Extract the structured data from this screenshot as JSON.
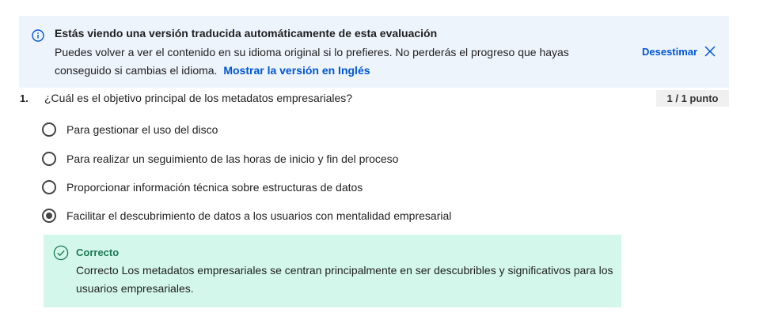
{
  "banner": {
    "title": "Estás viendo una versión traducida automáticamente de esta evaluación",
    "body": "Puedes volver a ver el contenido en su idioma original si lo prefieres. No perderás el progreso que hayas conseguido si cambias el idioma.",
    "link": "Mostrar la versión en Inglés",
    "dismiss_label": "Desestimar",
    "info_icon": "info-icon",
    "close_icon": "close-icon",
    "accent_color": "#0056d2"
  },
  "question": {
    "number": "1.",
    "text": "¿Cuál es el objetivo principal de los metadatos empresariales?",
    "points": "1 / 1 punto",
    "options": [
      {
        "label": "Para gestionar el uso del disco",
        "selected": false
      },
      {
        "label": "Para realizar un seguimiento de las horas de inicio y fin del proceso",
        "selected": false
      },
      {
        "label": "Proporcionar información técnica sobre estructuras de datos",
        "selected": false
      },
      {
        "label": "Facilitar el descubrimiento de datos a los usuarios con mentalidad empresarial",
        "selected": true
      }
    ]
  },
  "feedback": {
    "title": "Correcto",
    "text": "Correcto Los metadatos empresariales se centran principalmente en ser descubribles y significativos para los usuarios empresariales.",
    "icon": "check-circle-icon",
    "bg_color": "#d4f7ec",
    "title_color": "#1a7a53"
  }
}
